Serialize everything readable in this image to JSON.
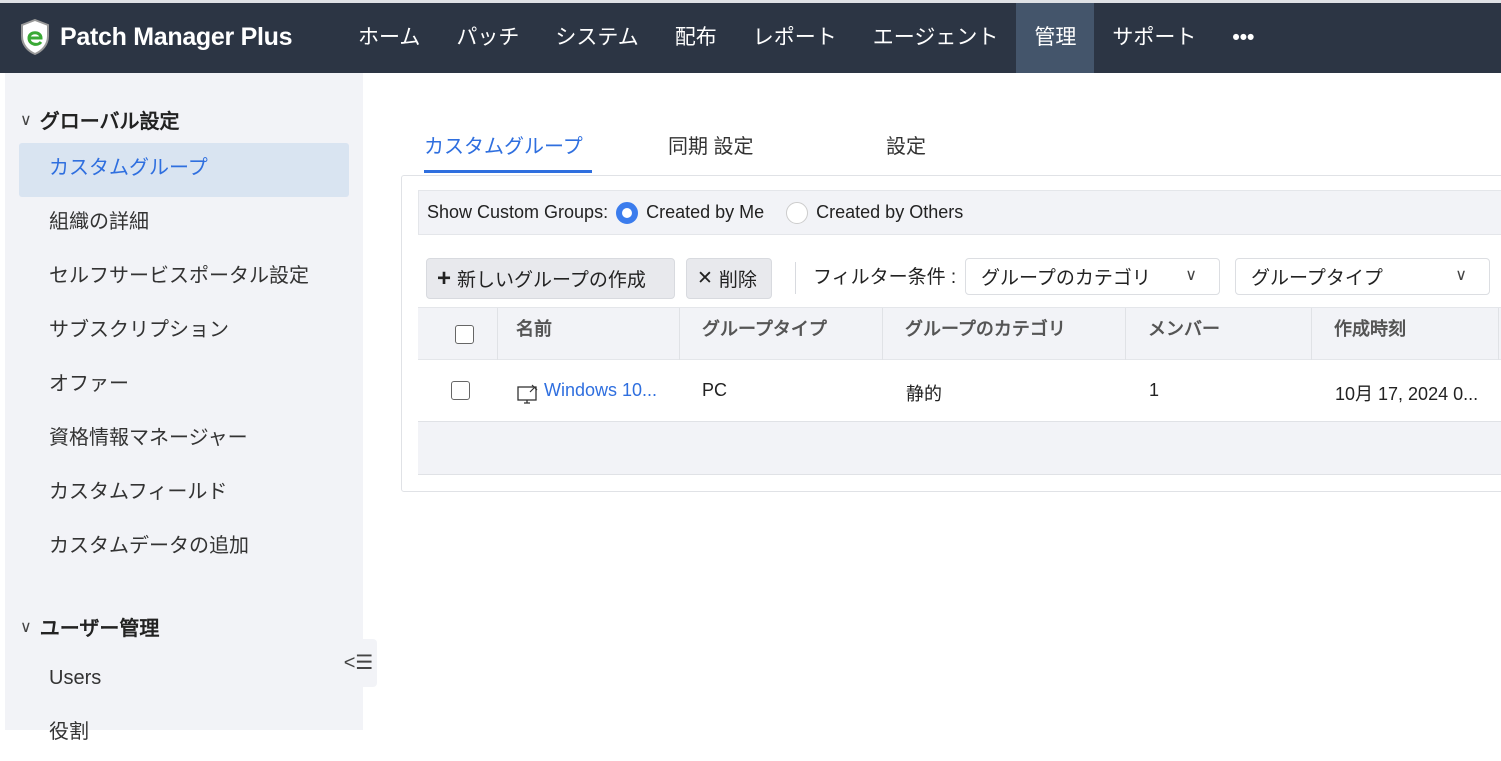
{
  "app": {
    "title": "Patch Manager Plus"
  },
  "nav": [
    "ホーム",
    "パッチ",
    "システム",
    "配布",
    "レポート",
    "エージェント",
    "管理",
    "サポート",
    "•••"
  ],
  "sidebar": {
    "section1": "グローバル設定",
    "items1": [
      "カスタムグループ",
      "組織の詳細",
      "セルフサービスポータル設定",
      "サブスクリプション",
      "オファー",
      "資格情報マネージャー",
      "カスタムフィールド",
      "カスタムデータの追加"
    ],
    "section2": "ユーザー管理",
    "items2": [
      "Users",
      "役割"
    ]
  },
  "tabs": [
    "カスタムグループ",
    "同期 設定",
    "設定"
  ],
  "show": {
    "label": "Show Custom Groups:",
    "opt1": "Created by Me",
    "opt2": "Created by Others"
  },
  "toolbar": {
    "new": "新しいグループの作成",
    "delete": "削除",
    "filter": "フィルター条件 :",
    "cat": "グループのカテゴリ",
    "type": "グループタイプ"
  },
  "table": {
    "headers": [
      "名前",
      "グループタイプ",
      "グループのカテゴリ",
      "メンバー",
      "作成時刻"
    ],
    "rows": [
      {
        "name": "Windows 10...",
        "type": "PC",
        "category": "静的",
        "members": "1",
        "created": "10月 17, 2024 0..."
      }
    ]
  },
  "colors": {
    "accent": "#2f6fdf",
    "topbar": "#2c3544"
  }
}
